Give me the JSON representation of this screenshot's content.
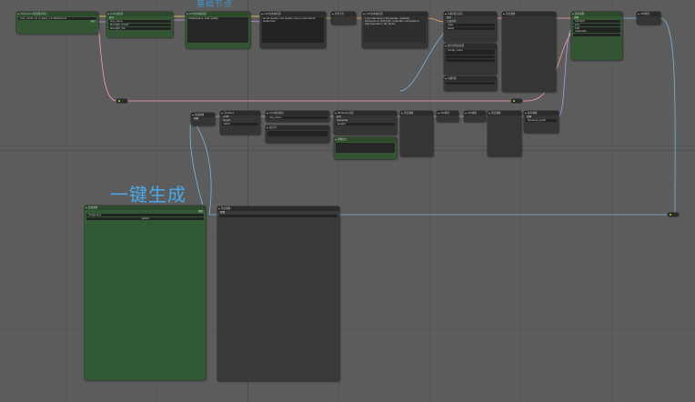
{
  "canvas": {
    "background": "#5c5c5c",
    "wire_colors": {
      "clip": "#e6d35a",
      "image": "#7fb3d5",
      "model": "#b39ddb",
      "latent": "#ff9fb0",
      "cond": "#e8a76a"
    }
  },
  "labels": {
    "group_top": "基础节点",
    "group_left": "一键生成"
  },
  "nodes": {
    "loader": {
      "title": "Checkpoint加载器(简易)",
      "value": "ckpt_name: sd_xl_base_1.0.safetensors",
      "outputs": [
        "模型",
        "CLIP",
        "VAE"
      ]
    },
    "lora": {
      "title": "LoRA加载器",
      "rows": [
        "模型",
        "CLIP",
        "lora_name",
        "strength_model",
        "strength_clip"
      ]
    },
    "prompt_pos": {
      "title": "CLIP文本编码器",
      "text": "masterpiece, best quality"
    },
    "prompt_neg": {
      "title": "CLIP文本编码器",
      "text": "worst quality, low quality, blurry, bad hands, watermark"
    },
    "cond_node": {
      "title": "条件合并"
    },
    "prompt_text": {
      "title": "CLIP文本编码器",
      "text": "a girl standing in the garden, detailed background, soft light, cinematic composition, high resolution, 8k, photo"
    },
    "ksampler": {
      "title": "K采样器(高级)",
      "rows": [
        "模型",
        "正面条件",
        "负面条件",
        "Latent",
        "seed",
        "steps",
        "cfg",
        "sampler",
        "scheduler"
      ]
    },
    "upscale_model": {
      "title": "放大模型加载器",
      "rows": [
        "model_name"
      ]
    },
    "sampler2": {
      "title": "K采样器",
      "rows": [
        "模型",
        "正面",
        "负面",
        "Latent",
        "seed",
        "control",
        "steps",
        "cfg"
      ]
    },
    "vae_decode_top": {
      "title": "VAE解码"
    },
    "preview_top": {
      "title": "预览图像"
    },
    "save_top": {
      "title": "保存图像",
      "rows": [
        "图像",
        "filename_prefix",
        "ComfyUI",
        "format",
        "png",
        "quality",
        "100",
        "metadata"
      ]
    },
    "vae_decode2": {
      "title": "VAE解码"
    },
    "image_node": {
      "title": "加载图像",
      "rows": [
        "图像",
        "遮罩"
      ]
    },
    "empty_latent": {
      "title": "空Latent",
      "rows": [
        "width",
        "height",
        "batch"
      ]
    },
    "clip_vision": {
      "title": "CLIP视觉编码",
      "rows": [
        "clip_vision"
      ]
    },
    "ipadapter": {
      "title": "IPAdapter高级",
      "rows": [
        "模型",
        "ipadapter",
        "图像",
        "weight"
      ]
    },
    "ipa_text": {
      "title": "提示词"
    },
    "upscale": {
      "title": "图像放大"
    },
    "decode3": {
      "title": "VAE解码"
    },
    "preview_mid": {
      "title": "预览图像"
    },
    "vae_small": {
      "title": "VAE编码"
    },
    "preview_right": {
      "title": "预览图像"
    },
    "save_right": {
      "title": "保存图像",
      "rows": [
        "图像",
        "filename_prefix"
      ]
    },
    "load_image_big": {
      "title": "加载图像",
      "rows": [
        "图像",
        "upload"
      ],
      "file": "image.png"
    },
    "preview_big": {
      "title": "预览图像",
      "rows": [
        "图像"
      ]
    },
    "reroute_small": {
      "title": "转接"
    }
  }
}
